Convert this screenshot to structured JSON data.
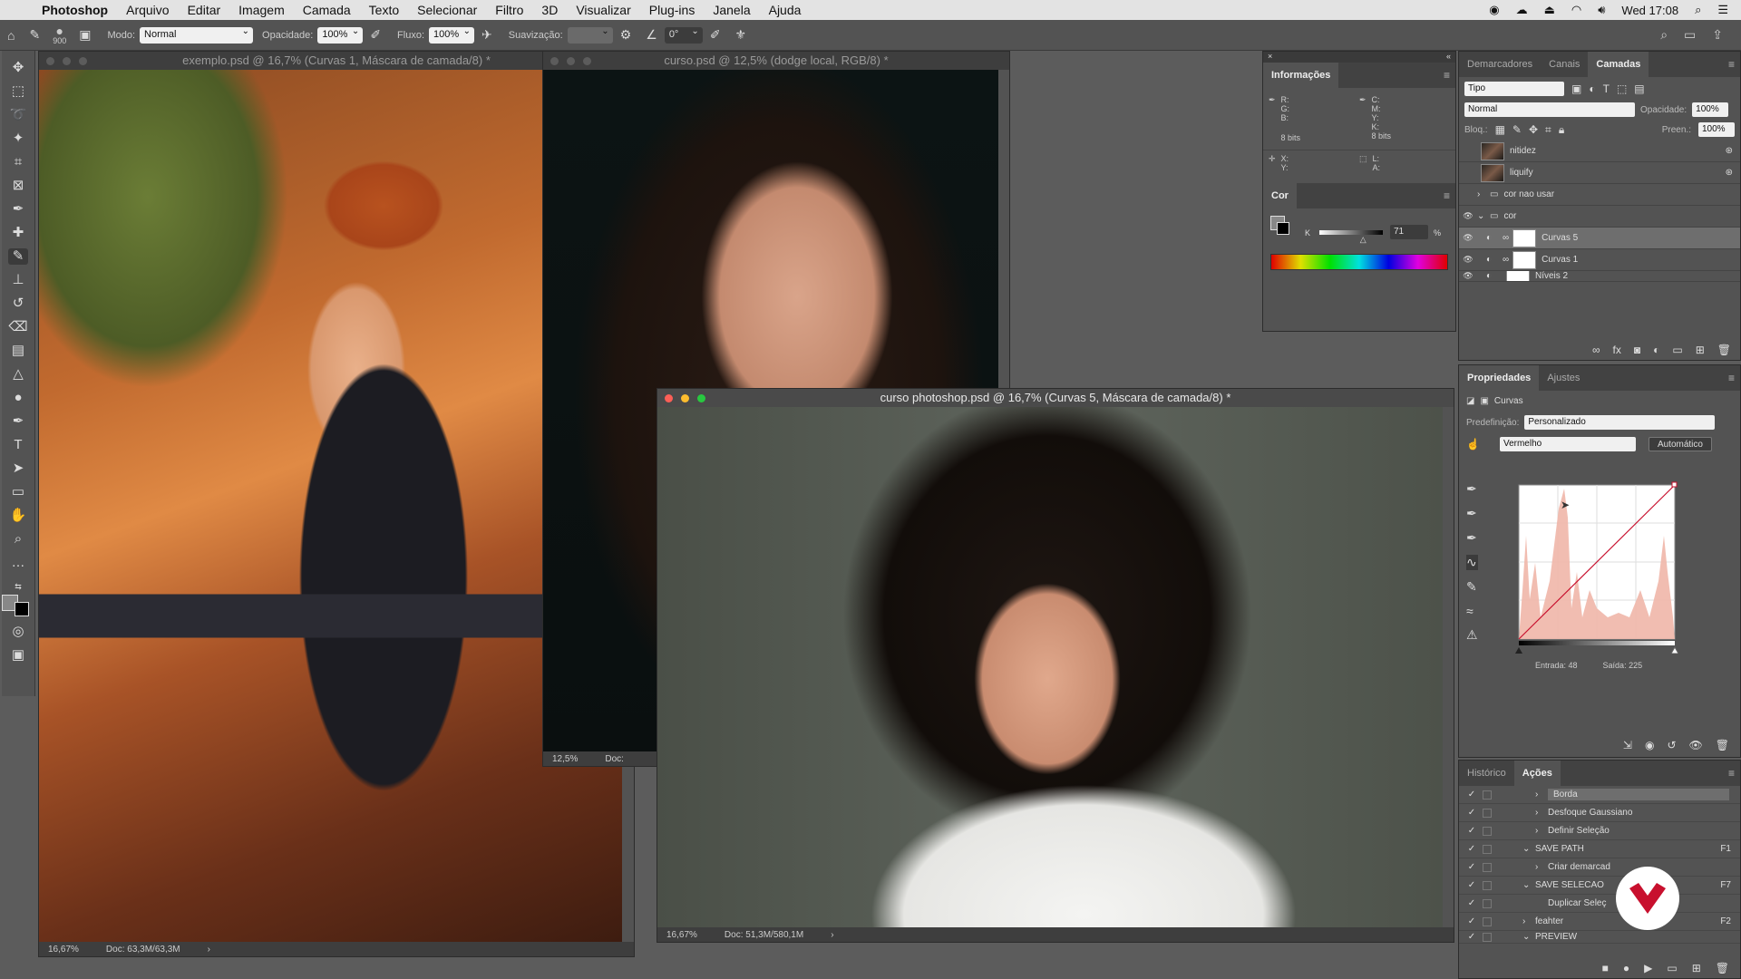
{
  "menubar": {
    "app": "Photoshop",
    "items": [
      "Arquivo",
      "Editar",
      "Imagem",
      "Camada",
      "Texto",
      "Selecionar",
      "Filtro",
      "3D",
      "Visualizar",
      "Plug-ins",
      "Janela",
      "Ajuda"
    ],
    "clock": "Wed 17:08"
  },
  "options": {
    "brush_size": "900",
    "mode_label": "Modo:",
    "mode_value": "Normal",
    "opacity_label": "Opacidade:",
    "opacity_value": "100%",
    "flow_label": "Fluxo:",
    "flow_value": "100%",
    "smooth_label": "Suavização:",
    "angle_value": "0°"
  },
  "docs": {
    "doc1": {
      "title": "exemplo.psd @ 16,7% (Curvas 1, Máscara de camada/8) *",
      "zoom": "16,67%",
      "info": "Doc: 63,3M/63,3M"
    },
    "doc2": {
      "title": "curso.psd @ 12,5% (dodge local, RGB/8) *",
      "zoom": "12,5%",
      "info": "Doc:"
    },
    "doc3": {
      "title": "curso photoshop.psd @ 16,7% (Curvas 5, Máscara de camada/8) *",
      "zoom": "16,67%",
      "info": "Doc: 51,3M/580,1M"
    }
  },
  "info_panel": {
    "tab": "Informações",
    "rgb": [
      "R:",
      "G:",
      "B:"
    ],
    "cmyk": [
      "C:",
      "M:",
      "Y:",
      "K:"
    ],
    "bits_left": "8 bits",
    "bits_right": "8 bits",
    "xy": [
      "X:",
      "Y:"
    ],
    "la": [
      "L:",
      "A:"
    ]
  },
  "color_panel": {
    "tab": "Cor",
    "channel": "K",
    "value": "71",
    "unit": "%",
    "level": 0.71
  },
  "layers_panel": {
    "tabs": [
      "Demarcadores",
      "Canais",
      "Camadas"
    ],
    "filter": "Tipo",
    "blend": "Normal",
    "opacity_label": "Opacidade:",
    "opacity_value": "100%",
    "lock_label": "Bloq.:",
    "fill_label": "Preen.:",
    "fill_value": "100%",
    "layers": [
      "nitidez",
      "liquify",
      "cor nao usar",
      "cor",
      "Curvas 5",
      "Curvas 1",
      "Níveis 2"
    ]
  },
  "properties_panel": {
    "tabs": [
      "Propriedades",
      "Ajustes"
    ],
    "type": "Curvas",
    "preset_label": "Predefinição:",
    "preset_value": "Personalizado",
    "channel": "Vermelho",
    "auto_button": "Automático",
    "input_label": "Entrada: 48",
    "output_label": "Saída: 225"
  },
  "actions_panel": {
    "tabs": [
      "Histórico",
      "Ações"
    ],
    "items": [
      {
        "name": "Borda",
        "key": ""
      },
      {
        "name": "Desfoque Gaussiano",
        "key": ""
      },
      {
        "name": "Definir Seleção",
        "key": ""
      },
      {
        "name": "SAVE PATH",
        "key": "F1"
      },
      {
        "name": "Criar demarcad",
        "key": ""
      },
      {
        "name": "SAVE SELECAO",
        "key": "F7"
      },
      {
        "name": "Duplicar Seleç",
        "key": ""
      },
      {
        "name": "feahter",
        "key": "F2"
      },
      {
        "name": "PREVIEW",
        "key": ""
      }
    ]
  },
  "colors": {
    "accent": "#c8102e",
    "panel": "#535353"
  }
}
